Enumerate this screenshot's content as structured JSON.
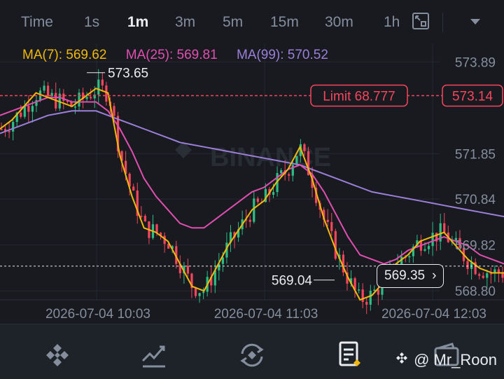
{
  "toolbar": {
    "timeframes": [
      "Time",
      "1s",
      "1m",
      "3m",
      "5m",
      "15m",
      "30m",
      "1h"
    ],
    "active": "1m"
  },
  "ma": [
    {
      "label": "MA(7): 569.62",
      "color": "#f0b90b"
    },
    {
      "label": "MA(25): 569.81",
      "color": "#e04fb0"
    },
    {
      "label": "MA(99): 570.52",
      "color": "#9b7fd9"
    }
  ],
  "colors": {
    "up": "#2ebd85",
    "down": "#f6465d",
    "accent": "#f0b90b"
  },
  "chart_data": {
    "type": "candlestick",
    "y_ticks": [
      "573.89",
      "571.85",
      "570.84",
      "569.82",
      "568.80"
    ],
    "x_ticks": [
      "2026-07-04 10:03",
      "2026-07-04 11:03",
      "2026-07-04 12:03"
    ],
    "ylim": [
      568.6,
      574.3
    ],
    "high_label": "573.65",
    "low_label": "569.04",
    "limit_label": "Limit 68.777",
    "limit_price": "573.14",
    "current_price": "569.35",
    "watermark": "BINANCE",
    "ma7": [
      572.4,
      572.6,
      572.9,
      573.2,
      573.1,
      573.0,
      572.9,
      573.1,
      573.3,
      573.2,
      571.8,
      570.9,
      570.2,
      570.1,
      569.9,
      569.4,
      568.9,
      568.8,
      569.3,
      569.8,
      570.2,
      570.6,
      570.8,
      571.2,
      571.5,
      572.0,
      571.3,
      570.4,
      569.7,
      569.1,
      568.6,
      568.7,
      569.0,
      569.4,
      569.6,
      569.9,
      570.0,
      570.1,
      569.8,
      569.5,
      569.3,
      569.2,
      569.2
    ],
    "ma25": [
      572.7,
      572.8,
      572.9,
      573.0,
      573.1,
      573.1,
      573.0,
      573.0,
      573.0,
      572.8,
      572.4,
      571.9,
      571.3,
      570.9,
      570.6,
      570.3,
      570.2,
      570.2,
      570.4,
      570.6,
      570.8,
      571.0,
      571.1,
      571.3,
      571.5,
      571.6,
      571.4,
      571.0,
      570.5,
      570.0,
      569.6,
      569.5,
      569.4,
      569.5,
      569.7,
      569.8,
      569.9,
      570.0,
      569.9,
      569.8,
      569.6,
      569.5,
      569.4
    ],
    "ma99": [
      572.3,
      572.4,
      572.5,
      572.6,
      572.7,
      572.75,
      572.8,
      572.8,
      572.8,
      572.7,
      572.6,
      572.5,
      572.4,
      572.3,
      572.2,
      572.1,
      572.05,
      572.0,
      571.95,
      571.9,
      571.85,
      571.8,
      571.75,
      571.7,
      571.65,
      571.6,
      571.5,
      571.4,
      571.3,
      571.2,
      571.1,
      571.0,
      570.95,
      570.9,
      570.85,
      570.8,
      570.75,
      570.7,
      570.65,
      570.6,
      570.55,
      570.5,
      570.45
    ]
  },
  "bottom_nav": {
    "icons": [
      "binance-logo-icon",
      "markets-chart-icon",
      "trade-swap-icon",
      "orders-doc-icon",
      "wallet-icon"
    ]
  },
  "watermark_user": "@ Mr_Roon"
}
